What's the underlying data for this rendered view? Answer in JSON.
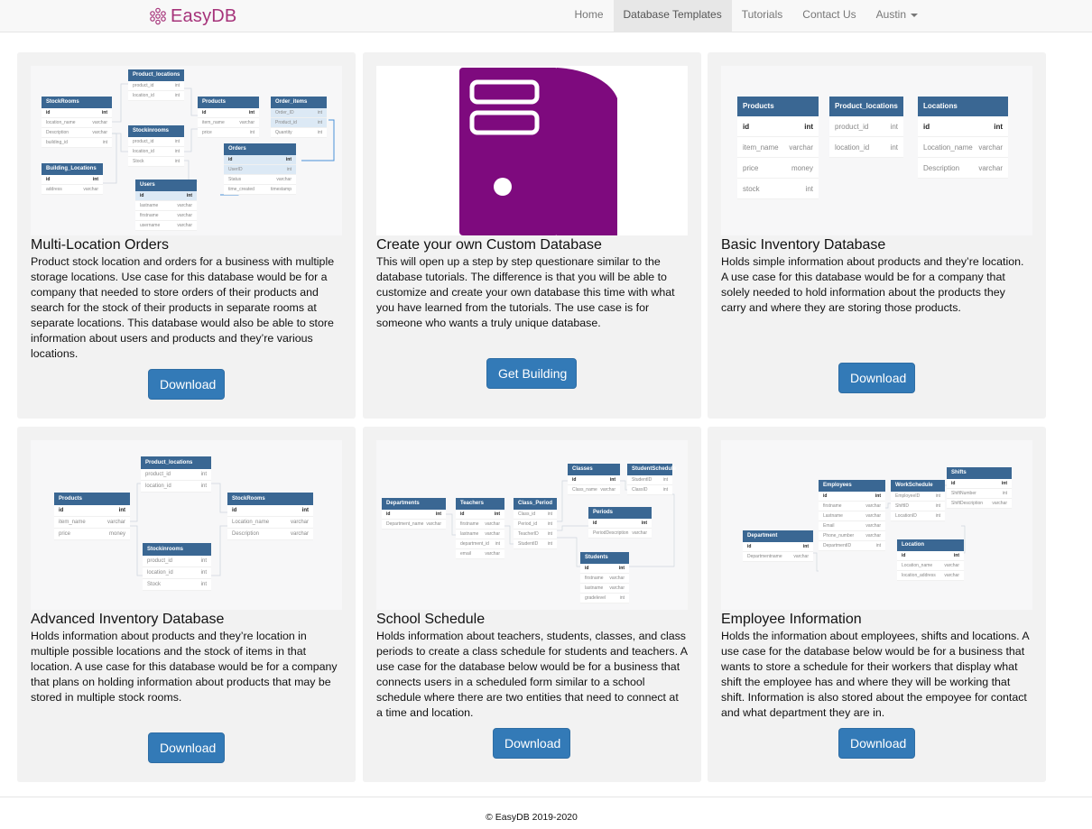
{
  "navbar": {
    "brand": "EasyDB",
    "items": [
      "Home",
      "Database Templates",
      "Tutorials",
      "Contact Us",
      "Austin"
    ]
  },
  "cards": [
    {
      "title": "Multi-Location Orders",
      "description": "Product stock location and orders for a business with multiple storage locations. Use case for this database would be for a company that needed to store orders of their products and search for the stock of their products in separate rooms at separate locations. This database would also be able to store information about users and products and they’re various locations.",
      "button": "Download"
    },
    {
      "title": "Create your own Custom Database",
      "description": "This will open up a step by step questionare similar to the database tutorials. The difference is that you will be able to customize and create your own database this time with what you have learned from the tutorials. The use case is for someone who wants a truly unique database.",
      "button": "Get Building"
    },
    {
      "title": "Basic Inventory Database",
      "description": "Holds simple information about products and they’re location. A use case for this database would be for a company that solely needed to hold information about the products they carry and where they are storing those products.",
      "button": "Download"
    },
    {
      "title": "Advanced Inventory Database",
      "description": "Holds information about products and they’re location in multiple possible locations and the stock of items in that location. A use case for this database would be for a company that plans on holding information about products that may be stored in multiple stock rooms.",
      "button": "Download"
    },
    {
      "title": "School Schedule",
      "description": "Holds information about teachers, students, classes, and class periods to create a class schedule for students and teachers. A use case for the database below would be for a business that connects users in a scheduled form similar to a school schedule where there are two entities that need to connect at a time and location.",
      "button": "Download"
    },
    {
      "title": "Employee Information",
      "description": "Holds the information about employees, shifts and locations. A use case for the database below would be for a business that wants to store a schedule for their workers that display what shift the employee has and where they will be working that shift. Information is also stored about the empoyee for contact and what department they are in.",
      "button": "Download"
    }
  ],
  "diagrams": {
    "multi": {
      "product_locations": {
        "name": "Product_locations",
        "rows": [
          [
            "product_id",
            "int"
          ],
          [
            "location_id",
            "int"
          ]
        ]
      },
      "stockrooms": {
        "name": "StockRooms",
        "rows": [
          [
            "id",
            "int"
          ],
          [
            "location_name",
            "varchar"
          ],
          [
            "Description",
            "varchar"
          ],
          [
            "building_id",
            "int"
          ]
        ]
      },
      "products": {
        "name": "Products",
        "rows": [
          [
            "id",
            "int"
          ],
          [
            "item_name",
            "varchar"
          ],
          [
            "price",
            "int"
          ]
        ]
      },
      "order_items": {
        "name": "Order_items",
        "rows": [
          [
            "Order_ID",
            "int"
          ],
          [
            "Product_id",
            "int"
          ],
          [
            "Quantity",
            "int"
          ]
        ]
      },
      "stockinrooms": {
        "name": "Stockinrooms",
        "rows": [
          [
            "product_id",
            "int"
          ],
          [
            "location_id",
            "int"
          ],
          [
            "Stock",
            "int"
          ]
        ]
      },
      "orders": {
        "name": "Orders",
        "rows": [
          [
            "id",
            "int"
          ],
          [
            "UserID",
            "int"
          ],
          [
            "Status",
            "varchar"
          ],
          [
            "time_created",
            "timestamp"
          ]
        ]
      },
      "building_locations": {
        "name": "Building_Locations",
        "rows": [
          [
            "id",
            "int"
          ],
          [
            "address",
            "varchar"
          ]
        ]
      },
      "users": {
        "name": "Users",
        "rows": [
          [
            "id",
            "int"
          ],
          [
            "lastname",
            "varchar"
          ],
          [
            "firstname",
            "varchar"
          ],
          [
            "username",
            "varchar"
          ]
        ]
      }
    },
    "basic": {
      "products": {
        "name": "Products",
        "rows": [
          [
            "id",
            "int"
          ],
          [
            "item_name",
            "varchar"
          ],
          [
            "price",
            "money"
          ],
          [
            "stock",
            "int"
          ]
        ]
      },
      "product_locations": {
        "name": "Product_locations",
        "rows": [
          [
            "product_id",
            "int"
          ],
          [
            "location_id",
            "int"
          ]
        ]
      },
      "locations": {
        "name": "Locations",
        "rows": [
          [
            "id",
            "int"
          ],
          [
            "Location_name",
            "varchar"
          ],
          [
            "Description",
            "varchar"
          ]
        ]
      }
    },
    "advanced": {
      "product_locations": {
        "name": "Product_locations",
        "rows": [
          [
            "product_id",
            "int"
          ],
          [
            "location_id",
            "int"
          ]
        ]
      },
      "products": {
        "name": "Products",
        "rows": [
          [
            "id",
            "int"
          ],
          [
            "item_name",
            "varchar"
          ],
          [
            "price",
            "money"
          ]
        ]
      },
      "stockrooms": {
        "name": "StockRooms",
        "rows": [
          [
            "id",
            "int"
          ],
          [
            "Location_name",
            "varchar"
          ],
          [
            "Description",
            "varchar"
          ]
        ]
      },
      "stockinrooms": {
        "name": "Stockinrooms",
        "rows": [
          [
            "product_id",
            "int"
          ],
          [
            "location_id",
            "int"
          ],
          [
            "Stock",
            "int"
          ]
        ]
      }
    },
    "school": {
      "departments": {
        "name": "Departments",
        "rows": [
          [
            "id",
            "int"
          ],
          [
            "Department_name",
            "varchar"
          ]
        ]
      },
      "teachers": {
        "name": "Teachers",
        "rows": [
          [
            "id",
            "int"
          ],
          [
            "firstname",
            "varchar"
          ],
          [
            "lastname",
            "varchar"
          ],
          [
            "department_id",
            "int"
          ],
          [
            "email",
            "varchar"
          ]
        ]
      },
      "class_period": {
        "name": "Class_Period",
        "rows": [
          [
            "Class_id",
            "int"
          ],
          [
            "Period_id",
            "int"
          ],
          [
            "TeacherID",
            "int"
          ],
          [
            "StudentID",
            "int"
          ]
        ]
      },
      "classes": {
        "name": "Classes",
        "rows": [
          [
            "id",
            "int"
          ],
          [
            "Class_name",
            "varchar"
          ]
        ]
      },
      "studentschedule": {
        "name": "StudentSchedule",
        "rows": [
          [
            "StudentID",
            "int"
          ],
          [
            "ClassID",
            "int"
          ]
        ]
      },
      "periods": {
        "name": "Periods",
        "rows": [
          [
            "id",
            "int"
          ],
          [
            "PeriodDescription",
            "varchar"
          ]
        ]
      },
      "students": {
        "name": "Students",
        "rows": [
          [
            "id",
            "int"
          ],
          [
            "firstname",
            "varchar"
          ],
          [
            "lastname",
            "varchar"
          ],
          [
            "gradelevel",
            "int"
          ]
        ]
      }
    },
    "employee": {
      "employees": {
        "name": "Employees",
        "rows": [
          [
            "id",
            "int"
          ],
          [
            "firstname",
            "varchar"
          ],
          [
            "Lastname",
            "varchar"
          ],
          [
            "Email",
            "varchar"
          ],
          [
            "Phone_number",
            "varchar"
          ],
          [
            "DepartmentID",
            "int"
          ]
        ]
      },
      "workschedule": {
        "name": "WorkSchedule",
        "rows": [
          [
            "EmployeeID",
            "int"
          ],
          [
            "ShiftID",
            "int"
          ],
          [
            "LocationID",
            "int"
          ]
        ]
      },
      "shifts": {
        "name": "Shifts",
        "rows": [
          [
            "id",
            "int"
          ],
          [
            "ShiftNumber",
            "int"
          ],
          [
            "ShiftDescription",
            "varchar"
          ]
        ]
      },
      "department": {
        "name": "Department",
        "rows": [
          [
            "id",
            "int"
          ],
          [
            "Departmentname",
            "varchar"
          ]
        ]
      },
      "location": {
        "name": "Location",
        "rows": [
          [
            "id",
            "int"
          ],
          [
            "Location_name",
            "varchar"
          ],
          [
            "location_address",
            "varchar"
          ]
        ]
      }
    }
  },
  "footer": {
    "copyright": "© EasyDB 2019-2020"
  },
  "colors": {
    "brand": "#a6337a",
    "primary_button": "#337ab7",
    "table_header": "#3a6793",
    "server_icon": "#7e0a7e"
  }
}
